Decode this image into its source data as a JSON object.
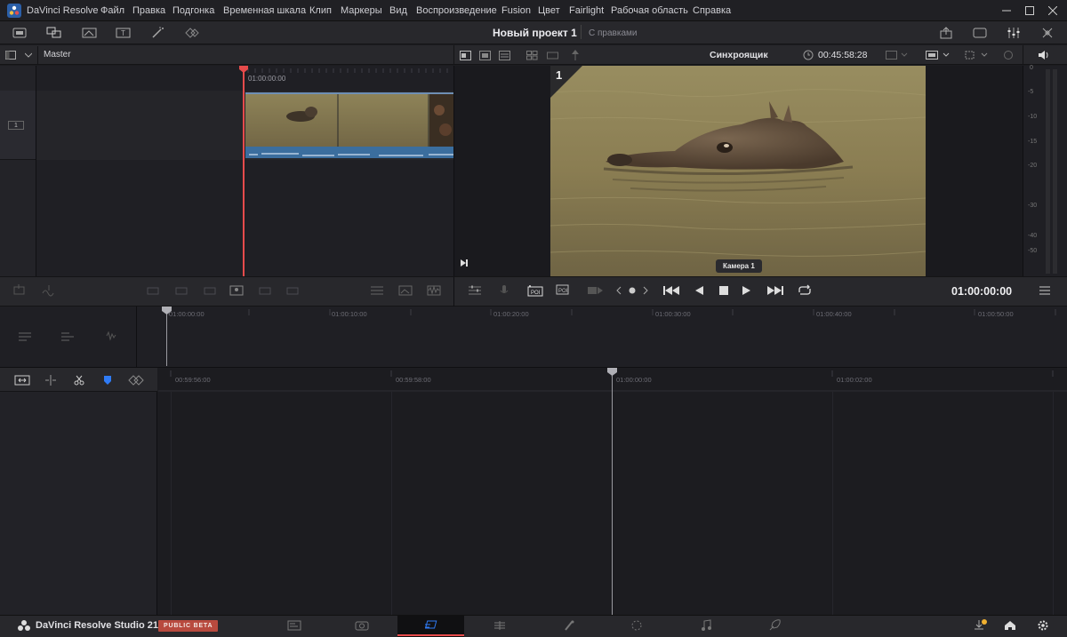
{
  "app": {
    "title": "DaVinci Resolve"
  },
  "menu": [
    "Файл",
    "Правка",
    "Подгонка",
    "Временная шкала",
    "Клип",
    "Маркеры",
    "Вид",
    "Воспроизведение",
    "Fusion",
    "Цвет",
    "Fairlight",
    "Рабочая область",
    "Справка"
  ],
  "project": {
    "title": "Новый проект 1",
    "status": "С правками"
  },
  "media_pool": {
    "bin_label": "Master",
    "track_number": "1",
    "timecode": "01:00:00:00"
  },
  "viewer": {
    "mode_label": "Синхроящик",
    "duration": "00:45:58:28",
    "angle_number": "1",
    "camera_label": "Камера 1",
    "timecode": "01:00:00:00"
  },
  "audio_meter": {
    "scale": [
      "0",
      "-5",
      "-10",
      "-15",
      "-20",
      "-30",
      "-40",
      "-50"
    ]
  },
  "upper_ruler": [
    "01:00:00:00",
    "01:00:10:00",
    "01:00:20:00",
    "01:00:30:00",
    "01:00:40:00",
    "01:00:50:00"
  ],
  "lower_ruler": [
    "00:59:56:00",
    "00:59:58:00",
    "01:00:00:00",
    "01:00:02:00"
  ],
  "bottom": {
    "app_name": "DaVinci Resolve Studio 21",
    "beta_badge": "PUBLIC BETA"
  },
  "colors": {
    "accent": "#e64b4b",
    "playhead": "#e64b4b",
    "clip_blue": "#3b6e9e",
    "active_page": "#e64b4b",
    "marker_blue": "#2f7bf5"
  }
}
